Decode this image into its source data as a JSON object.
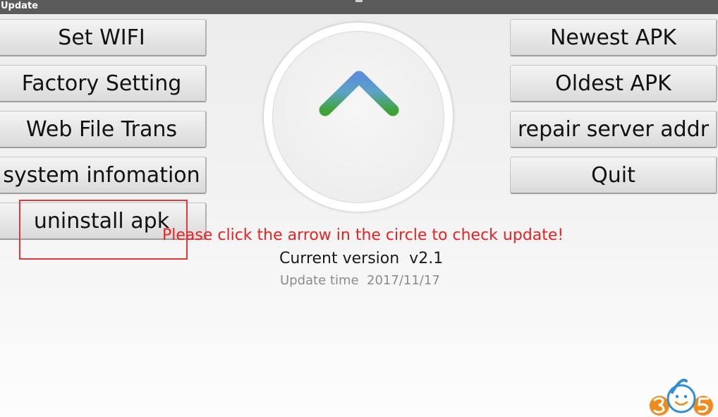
{
  "window": {
    "title": "Update"
  },
  "left_buttons": [
    {
      "label": "Set WIFI"
    },
    {
      "label": "Factory Setting"
    },
    {
      "label": "Web File Trans"
    },
    {
      "label": "system infomation"
    },
    {
      "label": "uninstall apk"
    }
  ],
  "right_buttons": [
    {
      "label": "Newest APK"
    },
    {
      "label": "Oldest APK"
    },
    {
      "label": "repair server addr"
    },
    {
      "label": "Quit"
    }
  ],
  "update_circle": {
    "icon": "up-arrow-icon",
    "arrow_colors": [
      "#5b8fd9",
      "#3fa33a"
    ]
  },
  "hint": {
    "text": "Please click the arrow in the circle to check update!",
    "color": "#e82222"
  },
  "version": {
    "text": "Current version  v2.1"
  },
  "update_time": {
    "text": "Update time  2017/11/17"
  },
  "highlight": {
    "color": "#e23a3a"
  },
  "watermark": {
    "text": "365",
    "icon": "365-logo-icon"
  }
}
